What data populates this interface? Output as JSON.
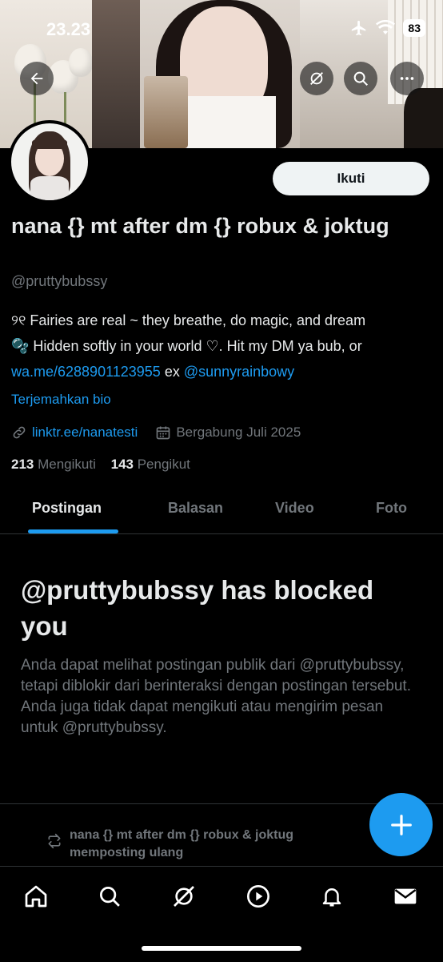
{
  "status_bar": {
    "time": "23.23",
    "battery": "83"
  },
  "profile": {
    "display_name": "nana {} mt after dm {} robux & joktug",
    "handle": "@pruttybubssy",
    "follow_label": "Ikuti",
    "bio": {
      "line1": "୨୧ Fairies are real ~ they breathe, do magic, and dream",
      "line2": "🫧 Hidden softly in your world ♡. Hit my DM ya bub, or",
      "link1": "wa.me/6288901123955",
      "connector": " ex ",
      "mention": "@sunnyrainbowy"
    },
    "translate_label": "Terjemahkan bio",
    "website": "linktr.ee/nanatesti",
    "joined": "Bergabung Juli 2025",
    "following_count": "213",
    "following_label": "Mengikuti",
    "followers_count": "143",
    "followers_label": "Pengikut"
  },
  "tabs": [
    {
      "label": "Postingan",
      "active": true
    },
    {
      "label": "Balasan",
      "active": false
    },
    {
      "label": "Video",
      "active": false
    },
    {
      "label": "Foto",
      "active": false
    }
  ],
  "blocked": {
    "title": "@pruttybubssy has blocked you",
    "description": "Anda dapat melihat postingan publik dari @pruttybubssy, tetapi diblokir dari berinteraksi dengan postingan tersebut. Anda juga tidak dapat mengikuti atau mengirim pesan untuk @pruttybubssy."
  },
  "repost_notice": {
    "line1": "nana {} mt after dm {} robux & joktug",
    "line2": "memposting ulang"
  },
  "icons": {
    "back": "back-arrow-icon",
    "grok": "grok-icon",
    "search": "search-icon",
    "more": "more-icon",
    "link": "link-icon",
    "calendar": "calendar-icon",
    "repost": "repost-icon",
    "compose": "plus-icon"
  },
  "bottom_nav": [
    {
      "name": "home-icon"
    },
    {
      "name": "search-icon"
    },
    {
      "name": "grok-icon"
    },
    {
      "name": "video-icon"
    },
    {
      "name": "notifications-icon"
    },
    {
      "name": "messages-icon"
    }
  ],
  "colors": {
    "accent": "#1d9bf0",
    "background": "#000000",
    "muted": "#71767b",
    "text": "#e7e9ea"
  }
}
